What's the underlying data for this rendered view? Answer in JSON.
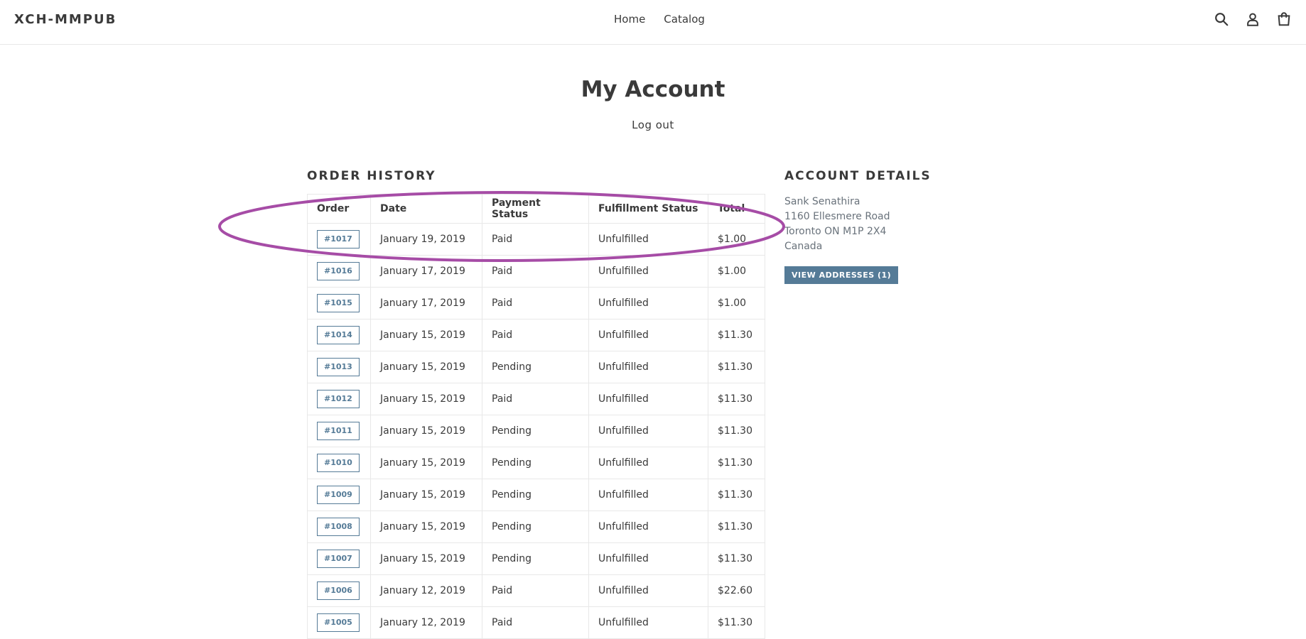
{
  "header": {
    "logo": "XCH-MMPUB",
    "nav": [
      "Home",
      "Catalog"
    ],
    "icons": [
      "search-icon",
      "account-icon",
      "cart-icon"
    ]
  },
  "page": {
    "title": "My Account",
    "logout": "Log out"
  },
  "order_history": {
    "heading": "ORDER HISTORY",
    "columns": [
      "Order",
      "Date",
      "Payment Status",
      "Fulfillment Status",
      "Total"
    ],
    "rows": [
      [
        "#1017",
        "January 19, 2019",
        "Paid",
        "Unfulfilled",
        "$1.00"
      ],
      [
        "#1016",
        "January 17, 2019",
        "Paid",
        "Unfulfilled",
        "$1.00"
      ],
      [
        "#1015",
        "January 17, 2019",
        "Paid",
        "Unfulfilled",
        "$1.00"
      ],
      [
        "#1014",
        "January 15, 2019",
        "Paid",
        "Unfulfilled",
        "$11.30"
      ],
      [
        "#1013",
        "January 15, 2019",
        "Pending",
        "Unfulfilled",
        "$11.30"
      ],
      [
        "#1012",
        "January 15, 2019",
        "Paid",
        "Unfulfilled",
        "$11.30"
      ],
      [
        "#1011",
        "January 15, 2019",
        "Pending",
        "Unfulfilled",
        "$11.30"
      ],
      [
        "#1010",
        "January 15, 2019",
        "Pending",
        "Unfulfilled",
        "$11.30"
      ],
      [
        "#1009",
        "January 15, 2019",
        "Pending",
        "Unfulfilled",
        "$11.30"
      ],
      [
        "#1008",
        "January 15, 2019",
        "Pending",
        "Unfulfilled",
        "$11.30"
      ],
      [
        "#1007",
        "January 15, 2019",
        "Pending",
        "Unfulfilled",
        "$11.30"
      ],
      [
        "#1006",
        "January 12, 2019",
        "Paid",
        "Unfulfilled",
        "$22.60"
      ],
      [
        "#1005",
        "January 12, 2019",
        "Paid",
        "Unfulfilled",
        "$11.30"
      ]
    ]
  },
  "account_details": {
    "heading": "ACCOUNT DETAILS",
    "address_lines": [
      "Sank Senathira",
      "1160 Ellesmere Road",
      "Toronto ON M1P 2X4",
      "Canada"
    ],
    "view_addresses_label": "VIEW ADDRESSES (1)"
  },
  "colors": {
    "accent": "#557b97",
    "annotation": "#a64ca6",
    "text": "#3a3a3a"
  }
}
